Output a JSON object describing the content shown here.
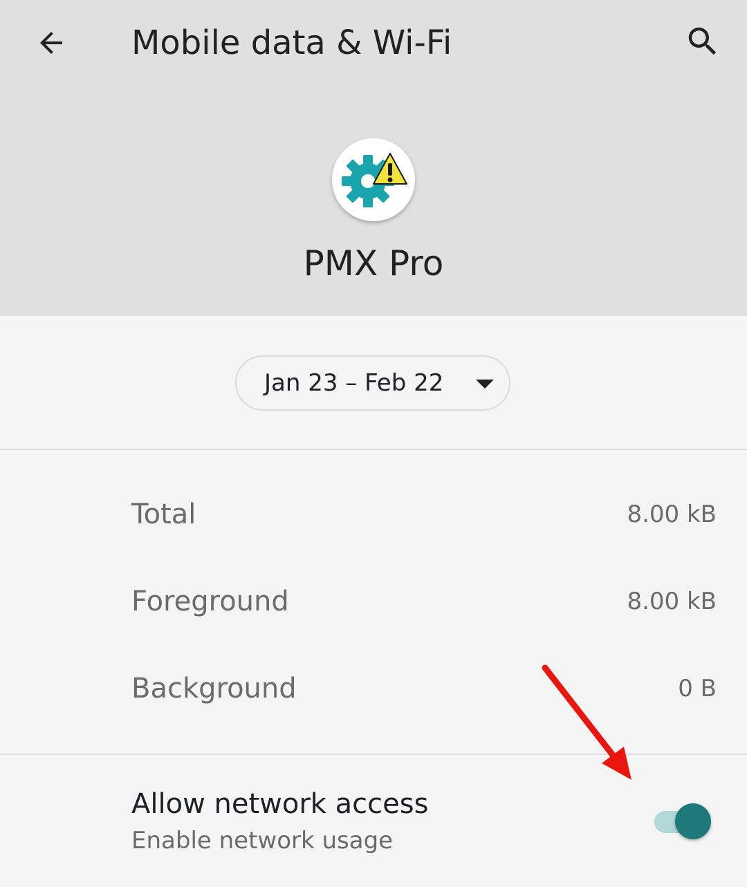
{
  "header": {
    "title": "Mobile data & Wi-Fi",
    "back_icon": "arrow-back-icon",
    "search_icon": "search-icon"
  },
  "app": {
    "name": "PMX Pro",
    "icon": "gear-warning-icon"
  },
  "cycle": {
    "label": "Jan 23 – Feb 22",
    "caret_icon": "caret-down-icon"
  },
  "usage": {
    "rows": [
      {
        "label": "Total",
        "value": "8.00 kB"
      },
      {
        "label": "Foreground",
        "value": "8.00 kB"
      },
      {
        "label": "Background",
        "value": "0 B"
      }
    ]
  },
  "network_access": {
    "title": "Allow network access",
    "summary": "Enable network usage",
    "enabled": true
  },
  "colors": {
    "header_bg": "#e0e0e0",
    "page_bg": "#f5f5f5",
    "accent": "#1e7a7a",
    "accent_track": "#b2d8d8",
    "annotation": "#e8160c"
  }
}
